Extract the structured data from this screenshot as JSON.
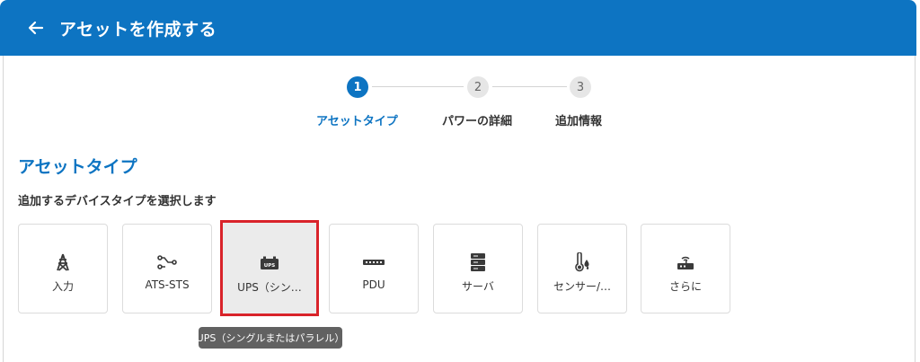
{
  "header": {
    "title": "アセットを作成する",
    "back_icon": "arrow-left-icon",
    "color": "#0d74c2"
  },
  "stepper": {
    "steps": [
      {
        "number": "1",
        "label": "アセットタイプ",
        "active": true
      },
      {
        "number": "2",
        "label": "パワーの詳細",
        "active": false
      },
      {
        "number": "3",
        "label": "追加情報",
        "active": false
      }
    ]
  },
  "section": {
    "title": "アセットタイプ",
    "subtitle": "追加するデバイスタイプを選択します"
  },
  "cards": [
    {
      "label": "入力",
      "icon": "power-tower-icon",
      "selected": false
    },
    {
      "label": "ATS-STS",
      "icon": "transfer-switch-icon",
      "selected": false
    },
    {
      "label": "UPS（シン…",
      "icon": "ups-battery-icon",
      "selected": true
    },
    {
      "label": "PDU",
      "icon": "pdu-strip-icon",
      "selected": false
    },
    {
      "label": "サーバ",
      "icon": "server-icon",
      "selected": false
    },
    {
      "label": "センサー/…",
      "icon": "sensor-icon",
      "selected": false
    },
    {
      "label": "さらに",
      "icon": "router-icon",
      "selected": false
    }
  ],
  "tooltip": {
    "text": "UPS（シングルまたはパラレル）"
  },
  "colors": {
    "accent": "#0d74c2",
    "selection_border": "#d9232a",
    "tooltip_bg": "#616161"
  }
}
